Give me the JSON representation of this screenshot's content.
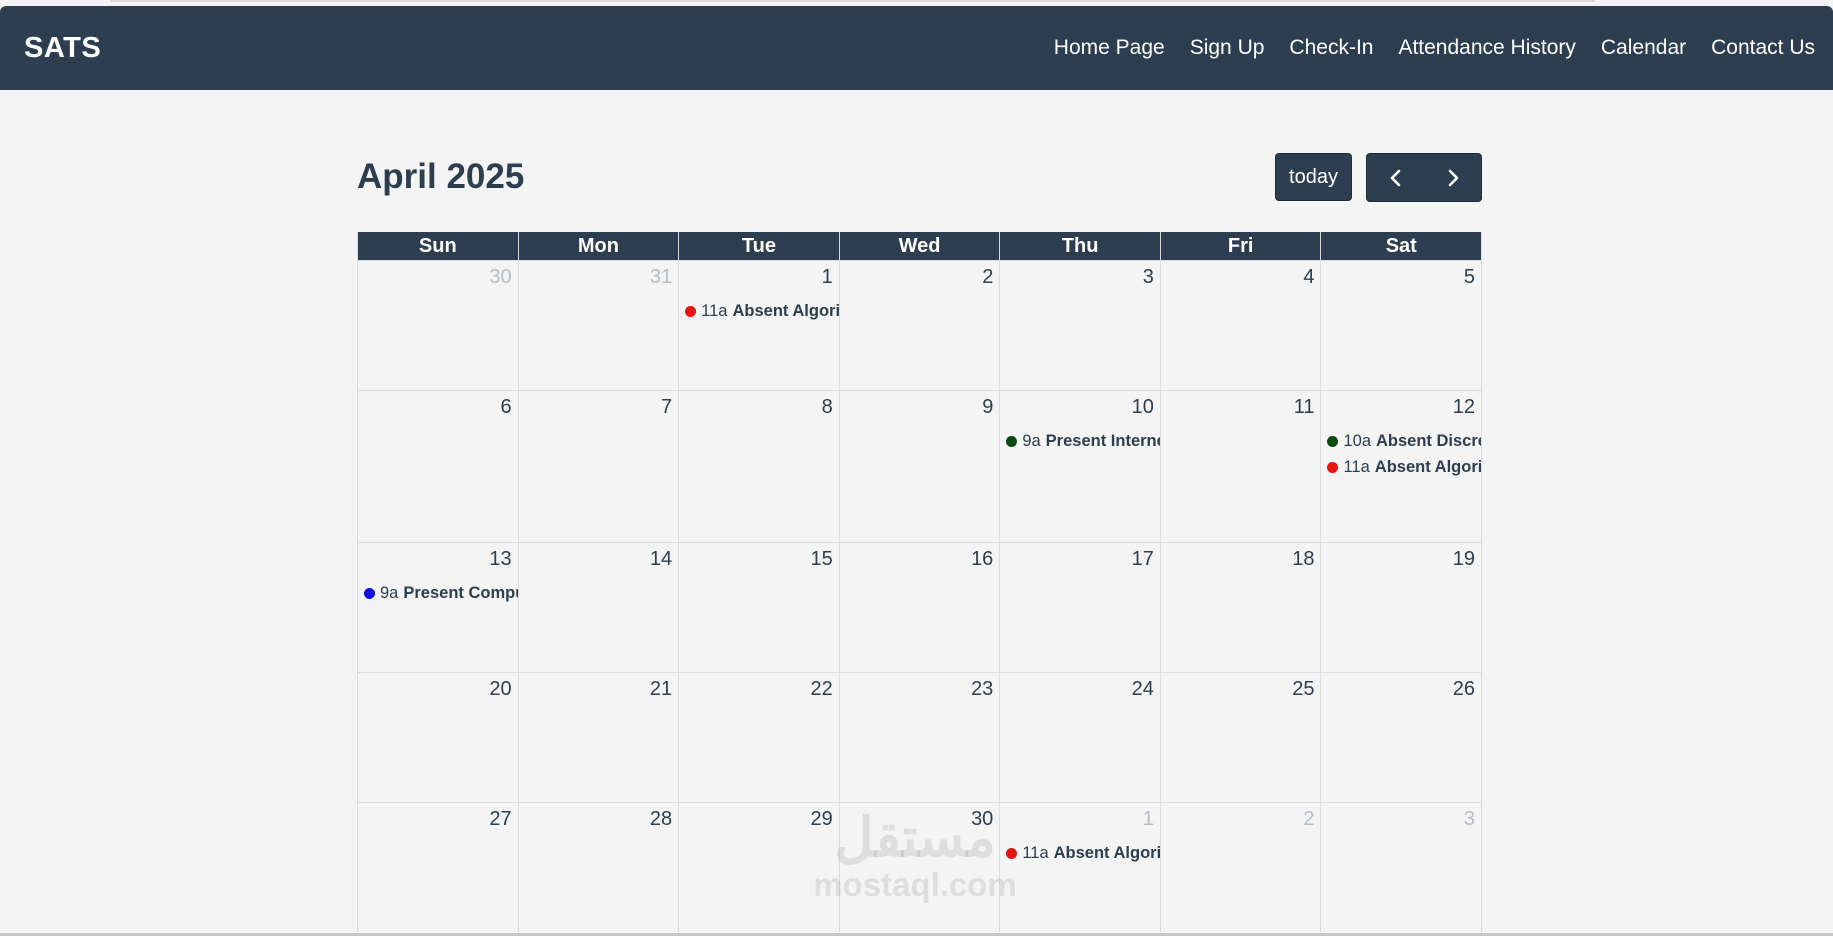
{
  "nav": {
    "brand": "SATS",
    "links": [
      "Home Page",
      "Sign Up",
      "Check-In",
      "Attendance History",
      "Calendar",
      "Contact Us"
    ]
  },
  "calendar": {
    "title": "April 2025",
    "today_label": "today",
    "day_headers": [
      "Sun",
      "Mon",
      "Tue",
      "Wed",
      "Thu",
      "Fri",
      "Sat"
    ],
    "weeks": [
      [
        {
          "num": "30",
          "other": true,
          "events": []
        },
        {
          "num": "31",
          "other": true,
          "events": []
        },
        {
          "num": "1",
          "other": false,
          "events": [
            {
              "time": "11a",
              "title": "Absent Algorithms",
              "color": "#e8140f"
            }
          ]
        },
        {
          "num": "2",
          "other": false,
          "events": []
        },
        {
          "num": "3",
          "other": false,
          "events": []
        },
        {
          "num": "4",
          "other": false,
          "events": []
        },
        {
          "num": "5",
          "other": false,
          "events": []
        }
      ],
      [
        {
          "num": "6",
          "other": false,
          "events": []
        },
        {
          "num": "7",
          "other": false,
          "events": []
        },
        {
          "num": "8",
          "other": false,
          "events": []
        },
        {
          "num": "9",
          "other": false,
          "events": []
        },
        {
          "num": "10",
          "other": false,
          "events": [
            {
              "time": "9a",
              "title": "Present Internet",
              "color": "#0d4a12"
            }
          ]
        },
        {
          "num": "11",
          "other": false,
          "events": []
        },
        {
          "num": "12",
          "other": false,
          "events": [
            {
              "time": "10a",
              "title": "Absent Discrete",
              "color": "#0d4a12"
            },
            {
              "time": "11a",
              "title": "Absent Algorithms",
              "color": "#e8140f"
            }
          ]
        }
      ],
      [
        {
          "num": "13",
          "other": false,
          "events": [
            {
              "time": "9a",
              "title": "Present Computer",
              "color": "#1010e0"
            }
          ]
        },
        {
          "num": "14",
          "other": false,
          "events": []
        },
        {
          "num": "15",
          "other": false,
          "events": []
        },
        {
          "num": "16",
          "other": false,
          "events": []
        },
        {
          "num": "17",
          "other": false,
          "events": []
        },
        {
          "num": "18",
          "other": false,
          "events": []
        },
        {
          "num": "19",
          "other": false,
          "events": []
        }
      ],
      [
        {
          "num": "20",
          "other": false,
          "events": []
        },
        {
          "num": "21",
          "other": false,
          "events": []
        },
        {
          "num": "22",
          "other": false,
          "events": []
        },
        {
          "num": "23",
          "other": false,
          "events": []
        },
        {
          "num": "24",
          "other": false,
          "events": []
        },
        {
          "num": "25",
          "other": false,
          "events": []
        },
        {
          "num": "26",
          "other": false,
          "events": []
        }
      ],
      [
        {
          "num": "27",
          "other": false,
          "events": []
        },
        {
          "num": "28",
          "other": false,
          "events": []
        },
        {
          "num": "29",
          "other": false,
          "events": []
        },
        {
          "num": "30",
          "other": false,
          "events": []
        },
        {
          "num": "1",
          "other": true,
          "events": [
            {
              "time": "11a",
              "title": "Absent Algorithms",
              "color": "#e8140f"
            }
          ]
        },
        {
          "num": "2",
          "other": true,
          "events": []
        },
        {
          "num": "3",
          "other": true,
          "events": []
        }
      ]
    ]
  },
  "watermark": {
    "arabic": "مستقل",
    "latin": "mostaql.com"
  }
}
